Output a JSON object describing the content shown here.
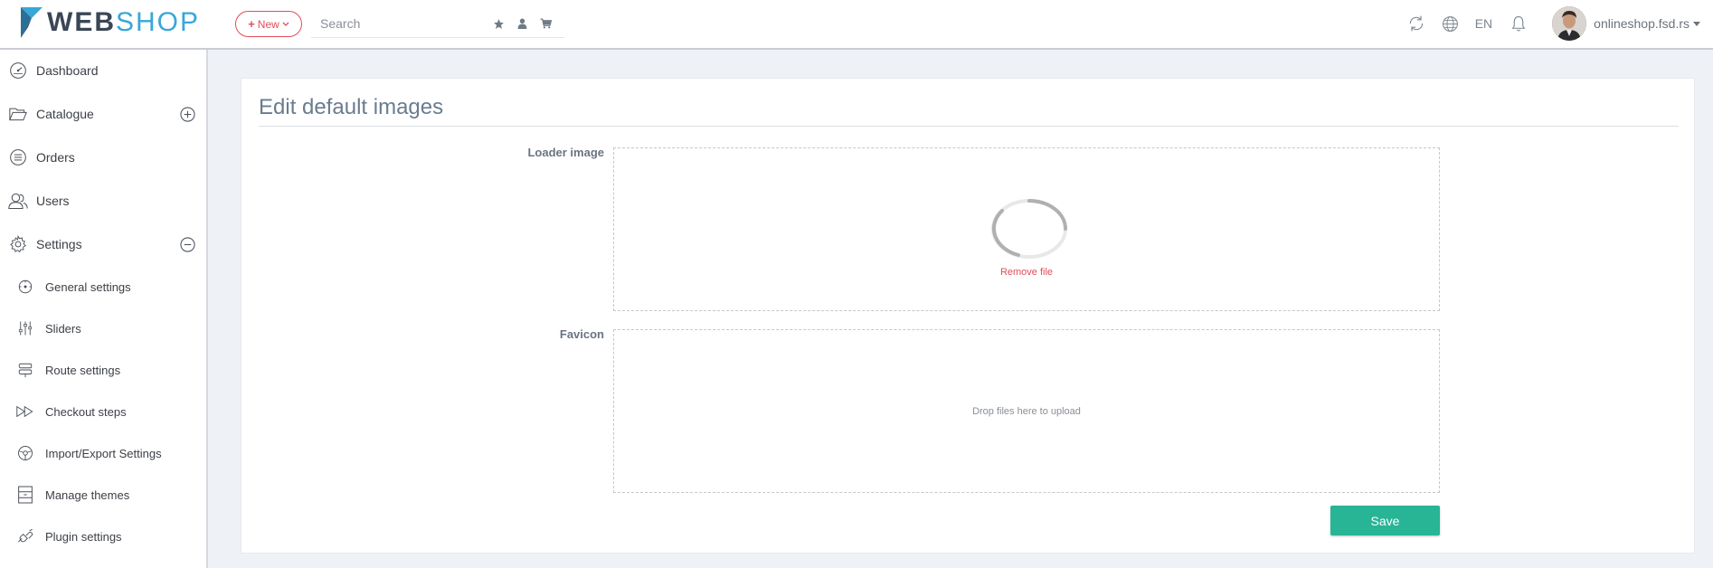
{
  "brand": {
    "name_part1": "WEB",
    "name_part2": "SHOP",
    "accent": "#37a7d8",
    "dark": "#3a4656"
  },
  "header": {
    "new_button": "New",
    "search_placeholder": "Search",
    "quick_icons": [
      "star-icon",
      "user-icon",
      "cart-icon"
    ],
    "right_icons": [
      "refresh-icon",
      "globe-icon"
    ],
    "language": "EN",
    "notification_icon": "bell-icon",
    "user_name": "onlineshop.fsd.rs"
  },
  "sidebar": {
    "items": [
      {
        "label": "Dashboard",
        "icon": "dashboard-icon"
      },
      {
        "label": "Catalogue",
        "icon": "folder-icon",
        "toggle": "expand"
      },
      {
        "label": "Orders",
        "icon": "list-icon"
      },
      {
        "label": "Users",
        "icon": "users-icon"
      },
      {
        "label": "Settings",
        "icon": "gear-icon",
        "toggle": "collapse"
      }
    ],
    "sub_items": [
      {
        "label": "General settings",
        "icon": "general-settings-icon"
      },
      {
        "label": "Sliders",
        "icon": "sliders-icon"
      },
      {
        "label": "Route settings",
        "icon": "route-icon"
      },
      {
        "label": "Checkout steps",
        "icon": "fast-forward-icon"
      },
      {
        "label": "Import/Export Settings",
        "icon": "steering-icon"
      },
      {
        "label": "Manage themes",
        "icon": "themes-icon"
      },
      {
        "label": "Plugin settings",
        "icon": "plugin-icon"
      }
    ]
  },
  "main": {
    "title": "Edit default images",
    "loader_label": "Loader image",
    "loader_remove": "Remove file",
    "favicon_label": "Favicon",
    "favicon_drop_text": "Drop files here to upload",
    "save_label": "Save"
  },
  "colors": {
    "danger": "#e24d57",
    "success": "#27b596",
    "title": "#6a7c90"
  }
}
